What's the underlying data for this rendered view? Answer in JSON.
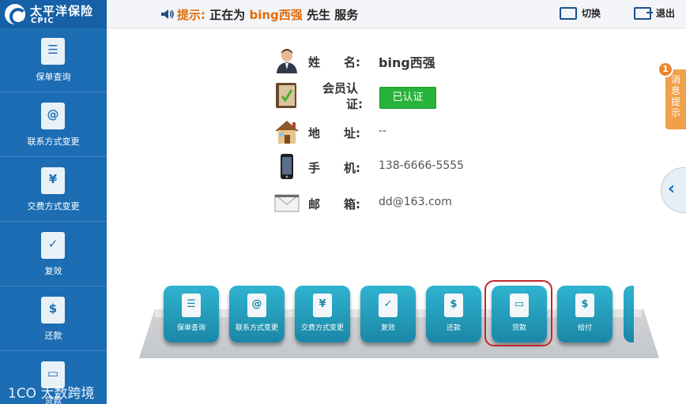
{
  "header": {
    "logo_cn": "太平洋保险",
    "logo_en": "CPIC",
    "notice_label": "提示:",
    "notice_pre": "正在为",
    "customer_name": "bing西强",
    "notice_post": "先生 服务",
    "switch_label": "切换",
    "exit_label": "退出"
  },
  "sidebar": {
    "items": [
      {
        "label": "保单查询",
        "icon": "policy-search-icon"
      },
      {
        "label": "联系方式变更",
        "icon": "contact-change-icon"
      },
      {
        "label": "交费方式变更",
        "icon": "payment-change-icon"
      },
      {
        "label": "复效",
        "icon": "reinstate-icon"
      },
      {
        "label": "还款",
        "icon": "repayment-icon"
      },
      {
        "label": "贷款",
        "icon": "loan-icon"
      }
    ],
    "watermark": "1CO 大数跨境"
  },
  "profile": {
    "name_key": "姓　　名:",
    "name_val": "bing西强",
    "member_key_l1": "会员认",
    "member_key_l2": "证:",
    "member_status": "已认证",
    "address_key": "地　　址:",
    "address_val": "--",
    "phone_key": "手　　机:",
    "phone_val": "138-6666-5555",
    "email_key": "邮　　箱:",
    "email_val": "dd@163.com"
  },
  "right_tabs": {
    "message_label": "消息提示",
    "message_count": "1"
  },
  "services": [
    {
      "label": "保单查询",
      "glyph": "☰"
    },
    {
      "label": "联系方式变更",
      "glyph": "@"
    },
    {
      "label": "交费方式变更",
      "glyph": "¥"
    },
    {
      "label": "复效",
      "glyph": "✓"
    },
    {
      "label": "还款",
      "glyph": "$"
    },
    {
      "label": "贷款",
      "glyph": "▭"
    },
    {
      "label": "给付",
      "glyph": "$"
    }
  ],
  "colors": {
    "sidebar": "#1c6db3",
    "accent": "#e36c09",
    "tile": "#1b86a8",
    "verified": "#27b33a",
    "highlight": "#c0272d"
  }
}
